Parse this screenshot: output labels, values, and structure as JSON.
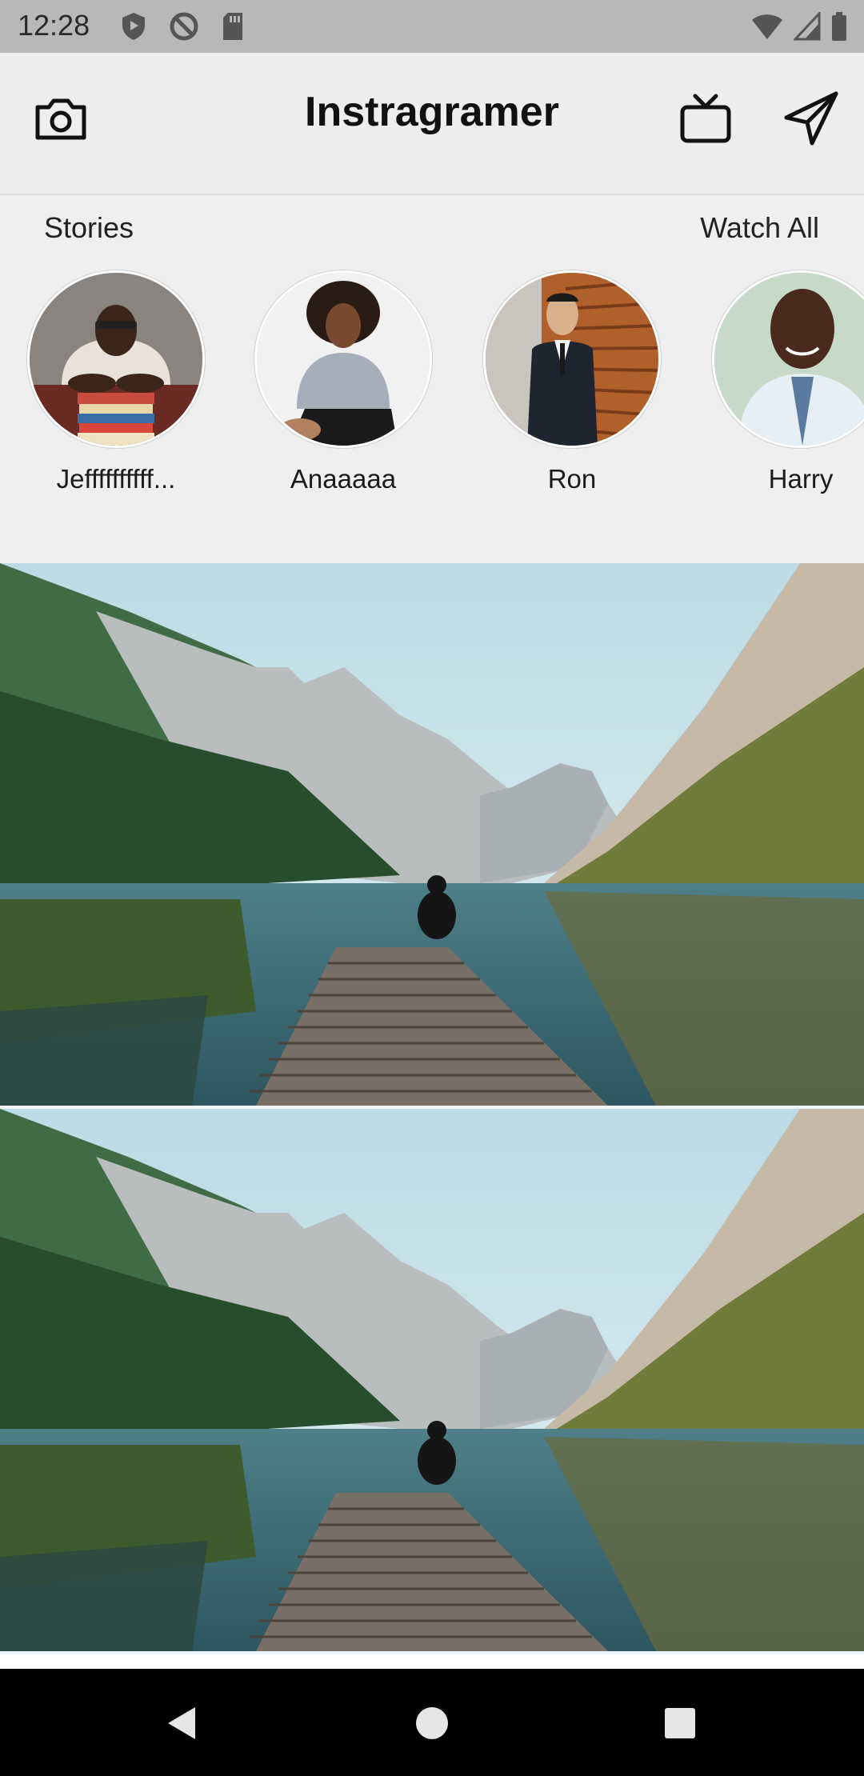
{
  "status_bar": {
    "time": "12:28"
  },
  "app_bar": {
    "title": "Instragramer"
  },
  "stories": {
    "header": "Stories",
    "watch_all": "Watch All",
    "items": [
      {
        "name": "Jeffffffffff..."
      },
      {
        "name": "Anaaaaa"
      },
      {
        "name": "Ron"
      },
      {
        "name": "Harry"
      }
    ]
  },
  "feed": {
    "posts": [
      {
        "image": "lake-pier-landscape"
      },
      {
        "image": "lake-pier-landscape"
      }
    ]
  },
  "colors": {
    "app_bar_bg": "#eeeeee",
    "status_bar_bg": "#b8b8b8",
    "nav_bar_bg": "#000000"
  }
}
